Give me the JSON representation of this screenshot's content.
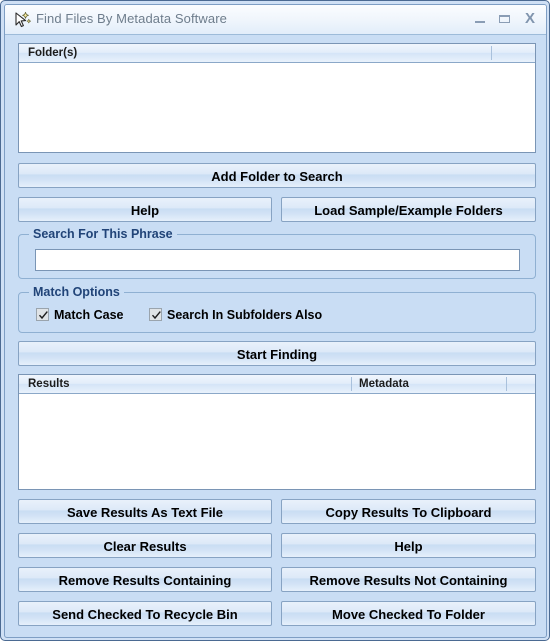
{
  "window": {
    "title": "Find Files By Metadata Software",
    "icon": "cursor-sparkle-icon",
    "controls": {
      "minimize": "–",
      "maximize": "□",
      "close": "X"
    }
  },
  "folders_list": {
    "columns": [
      "Folder(s)",
      ""
    ],
    "rows": []
  },
  "buttons": {
    "add_folder": "Add Folder to Search",
    "help_top": "Help",
    "load_sample": "Load Sample/Example Folders",
    "start_finding": "Start Finding",
    "save_results": "Save Results As Text File",
    "copy_results": "Copy Results To Clipboard",
    "clear_results": "Clear Results",
    "help_bottom": "Help",
    "remove_containing": "Remove Results Containing",
    "remove_not_containing": "Remove Results Not Containing",
    "send_recycle": "Send Checked To Recycle Bin",
    "move_folder": "Move Checked To Folder"
  },
  "search_group": {
    "label": "Search For This Phrase",
    "input_value": "",
    "input_placeholder": ""
  },
  "match_group": {
    "label": "Match Options",
    "options": [
      {
        "label": "Match Case",
        "checked": true
      },
      {
        "label": "Search In Subfolders Also",
        "checked": true
      }
    ]
  },
  "results_list": {
    "columns": [
      "Results",
      "Metadata",
      ""
    ],
    "rows": []
  },
  "colors": {
    "window_background": "#c9ddf4",
    "titlebar": "#eff5fc",
    "group_label": "#214478",
    "border": "#7a95b5",
    "title_text": "#6e7d8c"
  }
}
